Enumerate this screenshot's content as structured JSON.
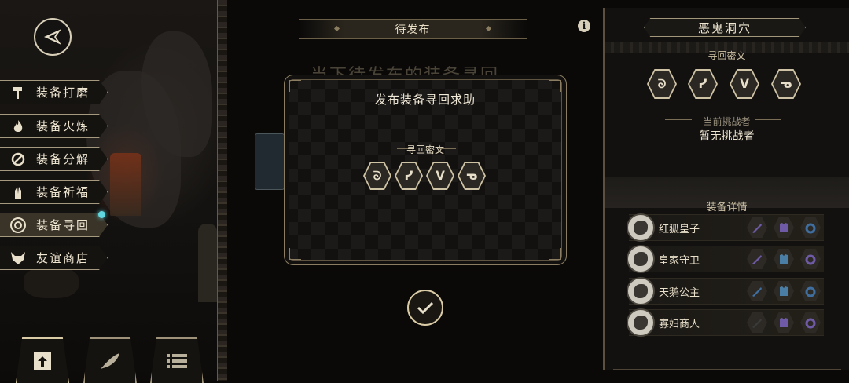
{
  "left_menu": {
    "items": [
      {
        "label": "装备打磨",
        "icon": "hammer-icon"
      },
      {
        "label": "装备火炼",
        "icon": "flame-icon"
      },
      {
        "label": "装备分解",
        "icon": "break-icon"
      },
      {
        "label": "装备祈福",
        "icon": "pray-icon"
      },
      {
        "label": "装备寻回",
        "icon": "target-icon"
      },
      {
        "label": "友谊商店",
        "icon": "fox-icon"
      }
    ],
    "active_index": 4
  },
  "center": {
    "pending_label": "待发布",
    "background_text": "当下待发布的装备寻回"
  },
  "modal": {
    "title": "发布装备寻回求助",
    "cipher_label": "寻回密文",
    "runes": [
      "ᘐ",
      "ᓯ",
      "ᐯ",
      "ᓀ"
    ]
  },
  "right_panel": {
    "location": "恶鬼洞穴",
    "cipher_label": "寻回密文",
    "runes": [
      "ᘐ",
      "ᓯ",
      "ᐯ",
      "ᓀ"
    ],
    "challenger_label": "当前挑战者",
    "challenger_value": "暂无挑战者",
    "equipment_label": "装备详情",
    "equipment": [
      {
        "name": "红狐皇子",
        "slots": [
          "#6f5aa8",
          "#6f5aa8",
          "#3f6fa0"
        ]
      },
      {
        "name": "皇家守卫",
        "slots": [
          "#6f5aa8",
          "#4a7ea6",
          "#6f5aa8"
        ]
      },
      {
        "name": "天鹅公主",
        "slots": [
          "#3f6fa0",
          "#4a7ea6",
          "#3f6fa0"
        ]
      },
      {
        "name": "寡妇商人",
        "slots": [
          "#3a3a3a",
          "#6f5aa8",
          "#6f5aa8"
        ]
      }
    ]
  },
  "colors": {
    "gold": "#d9cba6",
    "panel": "#121110"
  }
}
